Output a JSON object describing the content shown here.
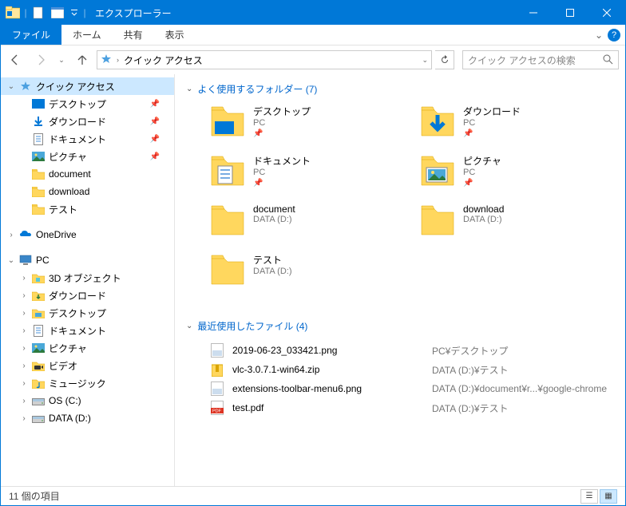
{
  "window": {
    "title": "エクスプローラー"
  },
  "ribbon": {
    "file": "ファイル",
    "tabs": [
      "ホーム",
      "共有",
      "表示"
    ]
  },
  "address": {
    "location": "クイック アクセス"
  },
  "search": {
    "placeholder": "クイック アクセスの検索"
  },
  "sidebar": {
    "quick_access": "クイック アクセス",
    "qa_items": [
      {
        "label": "デスクトップ",
        "icon": "desktop",
        "pinned": true
      },
      {
        "label": "ダウンロード",
        "icon": "downloads-blue",
        "pinned": true
      },
      {
        "label": "ドキュメント",
        "icon": "documents",
        "pinned": true
      },
      {
        "label": "ピクチャ",
        "icon": "pictures",
        "pinned": true
      },
      {
        "label": "document",
        "icon": "folder",
        "pinned": false
      },
      {
        "label": "download",
        "icon": "folder",
        "pinned": false
      },
      {
        "label": "テスト",
        "icon": "folder",
        "pinned": false
      }
    ],
    "onedrive": "OneDrive",
    "pc": "PC",
    "pc_items": [
      {
        "label": "3D オブジェクト",
        "icon": "folder-3d"
      },
      {
        "label": "ダウンロード",
        "icon": "downloads"
      },
      {
        "label": "デスクトップ",
        "icon": "desktop-folder"
      },
      {
        "label": "ドキュメント",
        "icon": "documents"
      },
      {
        "label": "ピクチャ",
        "icon": "pictures"
      },
      {
        "label": "ビデオ",
        "icon": "videos"
      },
      {
        "label": "ミュージック",
        "icon": "music"
      },
      {
        "label": "OS (C:)",
        "icon": "drive"
      },
      {
        "label": "DATA (D:)",
        "icon": "drive"
      }
    ]
  },
  "content": {
    "folders_header": "よく使用するフォルダー (7)",
    "folders": [
      {
        "name": "デスクトップ",
        "sub": "PC",
        "icon": "desktop-big",
        "pinned": true
      },
      {
        "name": "ダウンロード",
        "sub": "PC",
        "icon": "downloads-big",
        "pinned": true
      },
      {
        "name": "ドキュメント",
        "sub": "PC",
        "icon": "documents-big",
        "pinned": true
      },
      {
        "name": "ピクチャ",
        "sub": "PC",
        "icon": "pictures-big",
        "pinned": true
      },
      {
        "name": "document",
        "sub": "DATA (D:)",
        "icon": "folder-big",
        "pinned": false
      },
      {
        "name": "download",
        "sub": "DATA (D:)",
        "icon": "folder-big",
        "pinned": false
      },
      {
        "name": "テスト",
        "sub": "DATA (D:)",
        "icon": "folder-big",
        "pinned": false
      }
    ],
    "recent_header": "最近使用したファイル (4)",
    "recent": [
      {
        "name": "2019-06-23_033421.png",
        "path": "PC¥デスクトップ",
        "icon": "png"
      },
      {
        "name": "vlc-3.0.7.1-win64.zip",
        "path": "DATA (D:)¥テスト",
        "icon": "zip"
      },
      {
        "name": "extensions-toolbar-menu6.png",
        "path": "DATA (D:)¥document¥r...¥google-chrome",
        "icon": "png"
      },
      {
        "name": "test.pdf",
        "path": "DATA (D:)¥テスト",
        "icon": "pdf"
      }
    ]
  },
  "statusbar": {
    "text": "11 個の項目"
  }
}
